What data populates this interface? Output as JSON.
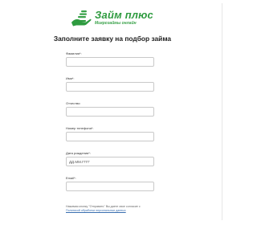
{
  "brand": {
    "title": "Займ плюс",
    "subtitle": "Микрозаймы онлайн",
    "accent": "#2e9b3f",
    "logo_icon": "hand-with-coins-icon"
  },
  "form": {
    "heading": "Заполните заявку на подбор займа",
    "fields": [
      {
        "label": "Фамилия*:",
        "value": "",
        "placeholder": ""
      },
      {
        "label": "Имя*:",
        "value": "",
        "placeholder": ""
      },
      {
        "label": "Отчество:",
        "value": "",
        "placeholder": ""
      },
      {
        "label": "Номер телефона*:",
        "value": "",
        "placeholder": ""
      },
      {
        "label": "Дата рождения*:",
        "value": "",
        "placeholder": "ДД.ММ.ГГГГ"
      },
      {
        "label": "Email*:",
        "value": "",
        "placeholder": ""
      }
    ]
  },
  "consent": {
    "text": "Нажимая кнопку \"Отправить\" Вы даете свое согласие с",
    "link": "Политикой обработки персональных данных"
  }
}
